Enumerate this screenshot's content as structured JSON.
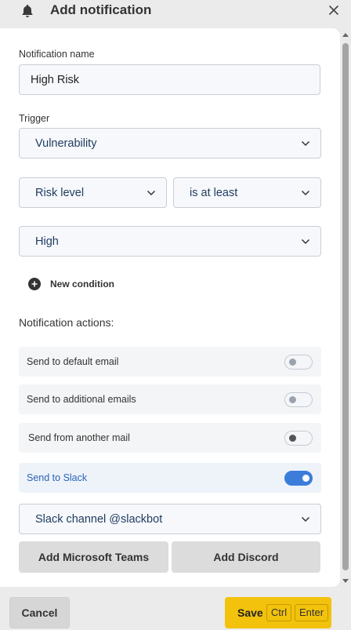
{
  "header": {
    "title": "Add notification",
    "icon": "bell-icon"
  },
  "form": {
    "name_label": "Notification name",
    "name_value": "High Risk",
    "trigger_label": "Trigger",
    "trigger_value": "Vulnerability",
    "condition": {
      "field_value": "Risk level",
      "operator_value": "is at least",
      "level_value": "High"
    },
    "new_condition_label": "New condition"
  },
  "actions": {
    "title": "Notification actions:",
    "items": [
      {
        "label": "Send to default email",
        "enabled": false
      },
      {
        "label": "Send to additional emails",
        "enabled": false
      },
      {
        "label": "Send from another mail",
        "enabled": false
      },
      {
        "label": "Send to Slack",
        "enabled": true
      }
    ],
    "slack_channel_value": "Slack channel @slackbot",
    "add_teams_label": "Add Microsoft Teams",
    "add_discord_label": "Add Discord"
  },
  "footer": {
    "cancel_label": "Cancel",
    "save_label": "Save",
    "shortcut_keys": [
      "Ctrl",
      "Enter"
    ]
  },
  "colors": {
    "accent": "#3b7dd8",
    "save_button": "#f2c20c",
    "active_row_text": "#2a64b5"
  }
}
